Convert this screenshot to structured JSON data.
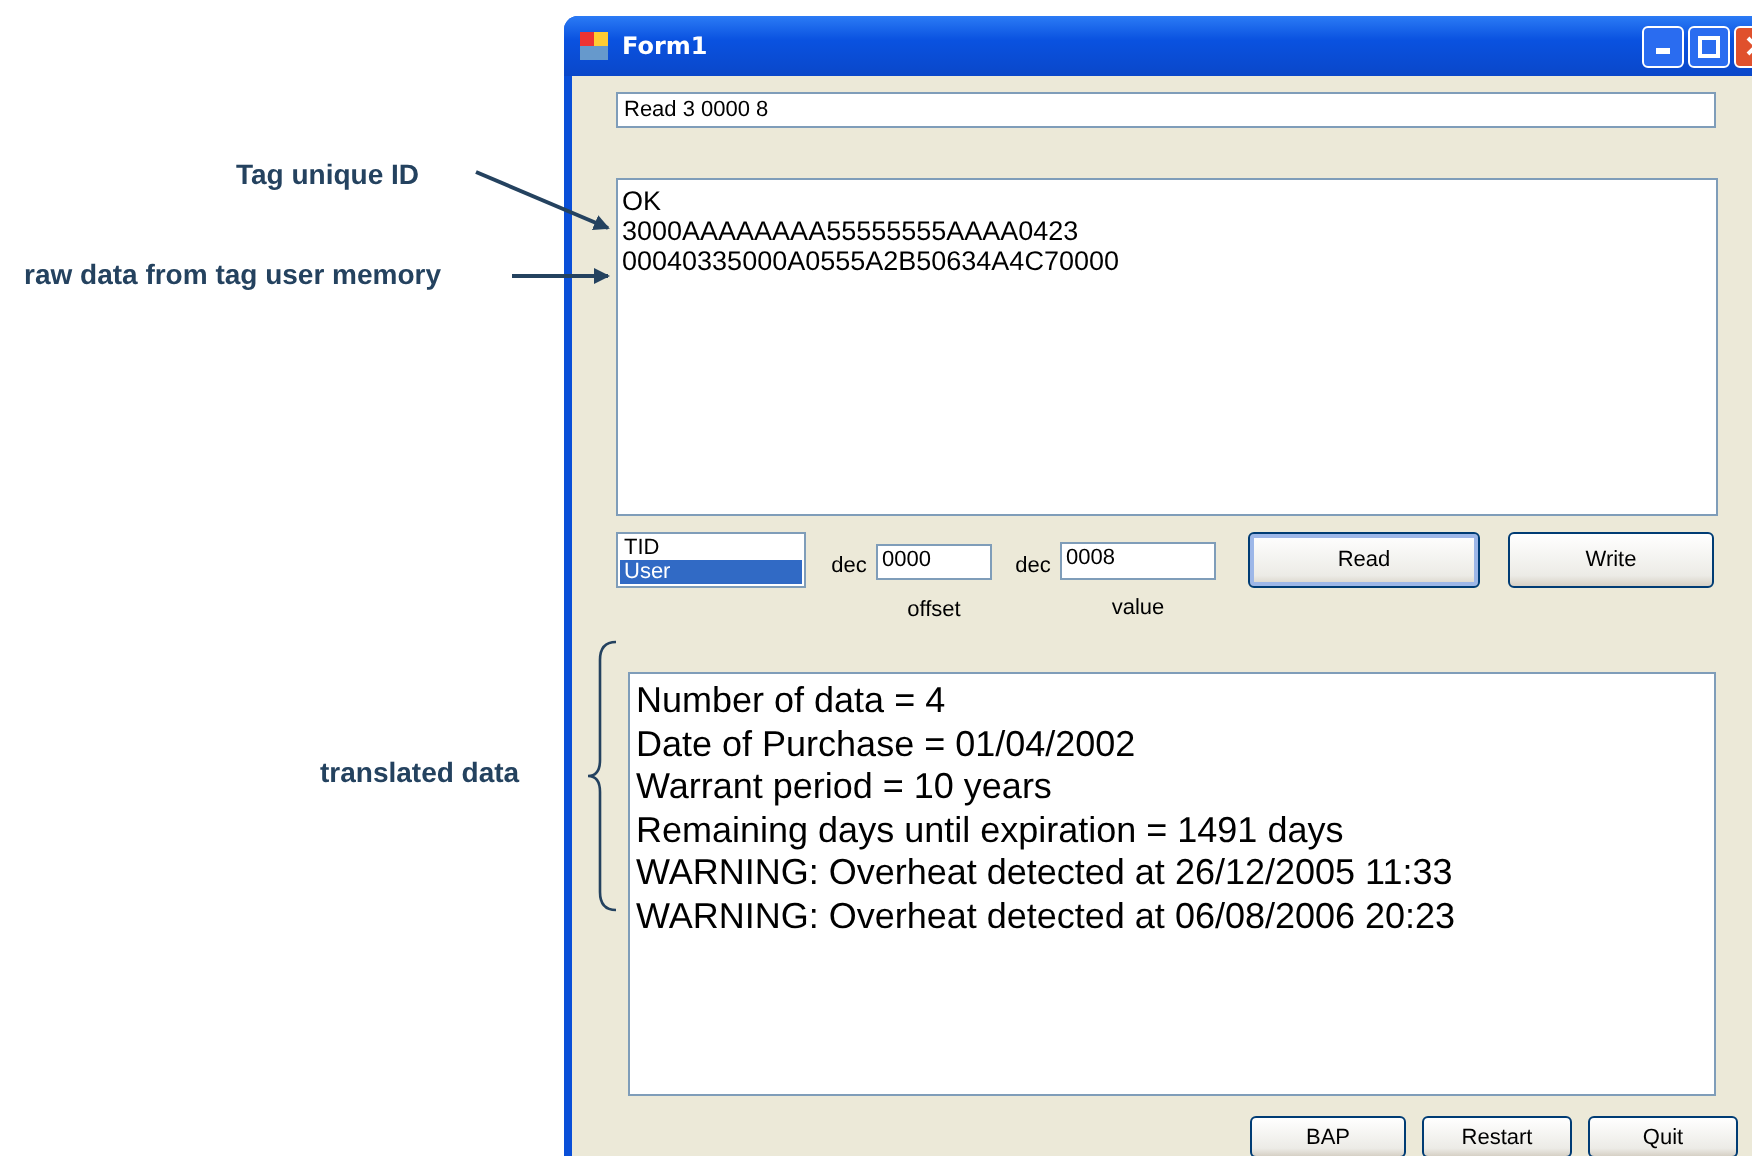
{
  "window": {
    "title": "Form1"
  },
  "command_field": {
    "value": "Read 3 0000 8"
  },
  "output_lines": [
    "OK",
    "3000AAAAAAAA55555555AAAA0423",
    "00040335000A0555A2B50634A4C70000"
  ],
  "memory_bank_list": [
    {
      "label": "TID",
      "selected": false
    },
    {
      "label": "User",
      "selected": true
    }
  ],
  "offset": {
    "prefix": "dec",
    "value": "0000",
    "caption": "offset"
  },
  "length": {
    "prefix": "dec",
    "value": "0008",
    "caption": "value"
  },
  "action_buttons": [
    "Read",
    "Write"
  ],
  "translated_lines": [
    "Number of data = 4",
    "Date of Purchase = 01/04/2002",
    "Warrant period = 10 years",
    "Remaining days until expiration = 1491 days",
    "WARNING: Overheat detected at 26/12/2005 11:33",
    "WARNING: Overheat detected at 06/08/2006 20:23"
  ],
  "bottom_buttons": [
    "BAP",
    "Restart",
    "Quit"
  ],
  "annotations": [
    {
      "kind": "arrow",
      "text": "Tag unique ID"
    },
    {
      "kind": "arrow",
      "text": "raw data from tag user memory"
    },
    {
      "kind": "brace",
      "text": "translated data"
    }
  ]
}
